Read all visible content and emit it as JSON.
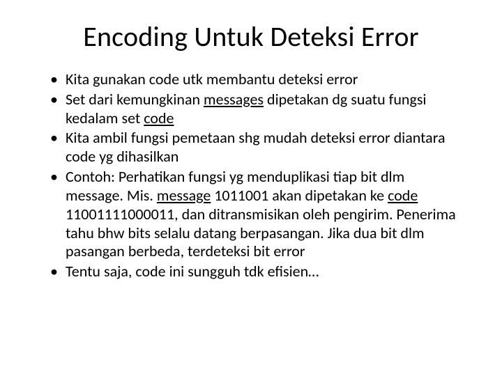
{
  "slide": {
    "title": "Encoding Untuk Deteksi Error",
    "bullets": [
      {
        "pre": "Kita gunakan code utk membantu deteksi error",
        "u1": "",
        "mid": "",
        "u2": "",
        "post": ""
      },
      {
        "pre": "Set dari kemungkinan ",
        "u1": "messages",
        "mid": " dipetakan dg suatu fungsi kedalam set ",
        "u2": "code",
        "post": ""
      },
      {
        "pre": "Kita ambil fungsi pemetaan shg mudah deteksi error diantara code yg dihasilkan",
        "u1": "",
        "mid": "",
        "u2": "",
        "post": ""
      },
      {
        "pre": "Contoh: Perhatikan fungsi yg menduplikasi tiap bit dlm message. Mis. ",
        "u1": "message",
        "mid": " 1011001 akan dipetakan ke ",
        "u2": "code",
        "post": " 11001111000011, dan ditransmisikan oleh pengirim. Penerima tahu bhw bits selalu datang berpasangan. Jika dua bit dlm pasangan berbeda, terdeteksi bit error"
      },
      {
        "pre": "Tentu saja, code ini sungguh tdk efisien…",
        "u1": "",
        "mid": "",
        "u2": "",
        "post": ""
      }
    ]
  }
}
